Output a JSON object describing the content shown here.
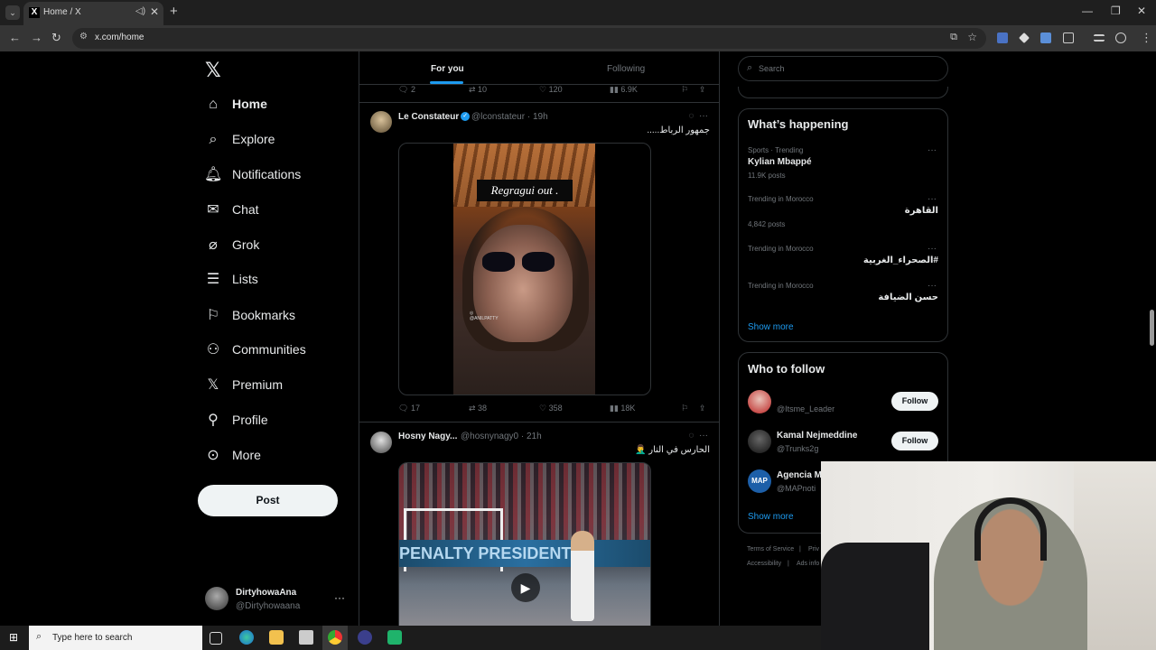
{
  "browser": {
    "tab_title": "Home / X",
    "url": "x.com/home"
  },
  "sidebar": {
    "items": [
      {
        "label": "Home",
        "icon": "home-icon"
      },
      {
        "label": "Explore",
        "icon": "search-icon"
      },
      {
        "label": "Notifications",
        "icon": "bell-icon"
      },
      {
        "label": "Chat",
        "icon": "envelope-icon"
      },
      {
        "label": "Grok",
        "icon": "grok-icon"
      },
      {
        "label": "Lists",
        "icon": "list-icon"
      },
      {
        "label": "Bookmarks",
        "icon": "bookmark-icon"
      },
      {
        "label": "Communities",
        "icon": "people-icon"
      },
      {
        "label": "Premium",
        "icon": "x-icon"
      },
      {
        "label": "Profile",
        "icon": "person-icon"
      },
      {
        "label": "More",
        "icon": "more-circle-icon"
      }
    ],
    "post_label": "Post",
    "account": {
      "name": "DirtyhowaAna",
      "handle": "@Dirtyhowaana"
    }
  },
  "timeline": {
    "tabs": [
      "For you",
      "Following"
    ],
    "prev_tweet_stats": {
      "replies": "2",
      "reposts": "10",
      "likes": "120",
      "views": "6.9K"
    },
    "tweets": [
      {
        "name": "Le Constateur",
        "handle": "@lconstateur",
        "time": "· 19h",
        "text": "جمهور الرباط.....",
        "media_caption": "Regragui out .",
        "media_tag": "@ANILPATTY",
        "stats": {
          "replies": "17",
          "reposts": "38",
          "likes": "358",
          "views": "18K"
        }
      },
      {
        "name": "Hosny Nagy...",
        "handle": "@hosnynagy0",
        "time": "· 21h",
        "text": "الحارس في النار 🤦‍♂️",
        "media_banner": "PENALTY PRESIDENT"
      }
    ]
  },
  "right": {
    "search_placeholder": "Search",
    "whats_happening": {
      "title": "What’s happening",
      "trends": [
        {
          "category": "Sports · Trending",
          "name": "Kylian Mbappé",
          "count": "11.9K posts",
          "rtl": false
        },
        {
          "category": "Trending in Morocco",
          "name": "القاهرة",
          "count": "4,842 posts",
          "rtl": true
        },
        {
          "category": "Trending in Morocco",
          "name": "#الصحراء_الغربية",
          "count": "",
          "rtl": true
        },
        {
          "category": "Trending in Morocco",
          "name": "حسن الضيافة",
          "count": "",
          "rtl": true
        }
      ],
      "show_more": "Show more"
    },
    "who_to_follow": {
      "title": "Who to follow",
      "users": [
        {
          "name": "",
          "handle": "@Itsme_Leader",
          "button": "Follow"
        },
        {
          "name": "Kamal Nejmeddine",
          "handle": "@Trunks2g",
          "button": "Follow"
        },
        {
          "name": "Agencia M",
          "handle": "@MAPnoti",
          "button": ""
        }
      ],
      "show_more": "Show more"
    },
    "footer": [
      "Terms of Service",
      "|",
      "Priv",
      "Accessibility",
      "|",
      "Ads info"
    ]
  },
  "taskbar": {
    "search_placeholder": "Type here to search"
  },
  "colors": {
    "accent": "#1d9bf0",
    "background": "#000000",
    "border": "#2f3336",
    "muted": "#71767b"
  }
}
